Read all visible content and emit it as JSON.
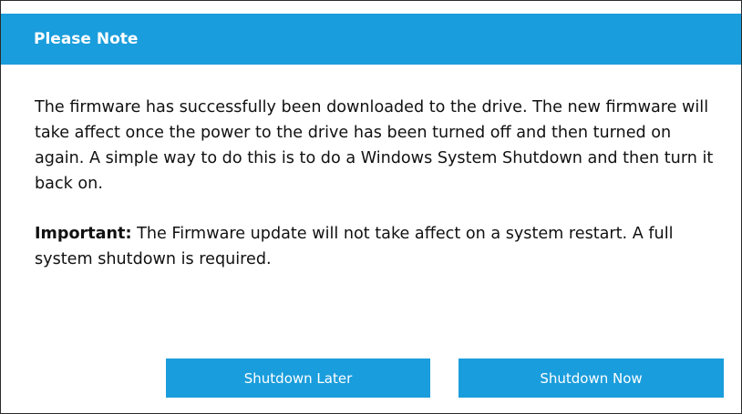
{
  "dialog": {
    "title": "Please Note",
    "paragraph1": "The firmware has successfully been downloaded to the drive. The new firmware will take affect once the power to the drive has been turned off and then turned on again. A simple way to do this is to do a Windows System Shutdown and then turn it back on.",
    "important_label": "Important:",
    "important_text": " The Firmware update will not take affect on a system restart. A full system shutdown is required.",
    "buttons": {
      "later_label": "Shutdown Later",
      "now_label": "Shutdown Now"
    }
  },
  "colors": {
    "accent": "#1a9ddc",
    "text": "#111111",
    "border": "#2b2b2b",
    "background": "#ffffff"
  }
}
